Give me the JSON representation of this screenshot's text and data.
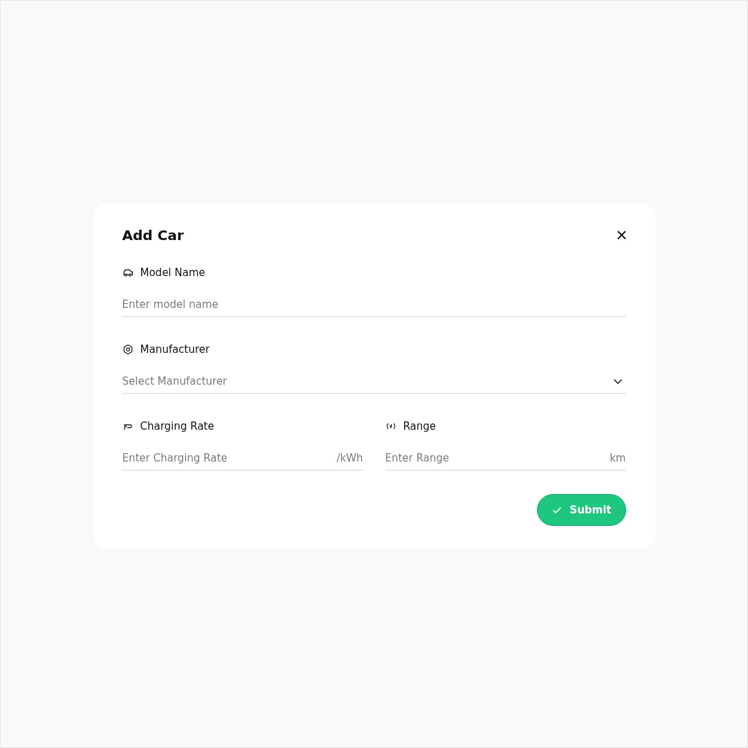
{
  "dialog": {
    "title": "Add Car",
    "close": "×"
  },
  "rows": [
    [
      {
        "kind": "text",
        "label": "Model Name",
        "placeholder": "Enter model name"
      }
    ],
    [
      {
        "kind": "select",
        "label": "Manufacturer",
        "placeholder": "Select Manufacturer"
      }
    ],
    [
      {
        "kind": "unit",
        "label": "Charging Rate",
        "placeholder": "Enter Charging Rate",
        "unit": "/kWh"
      },
      {
        "kind": "unit",
        "label": "Range",
        "placeholder": "Enter Range",
        "unit": "km"
      }
    ]
  ],
  "submit": {
    "label": "Submit"
  }
}
